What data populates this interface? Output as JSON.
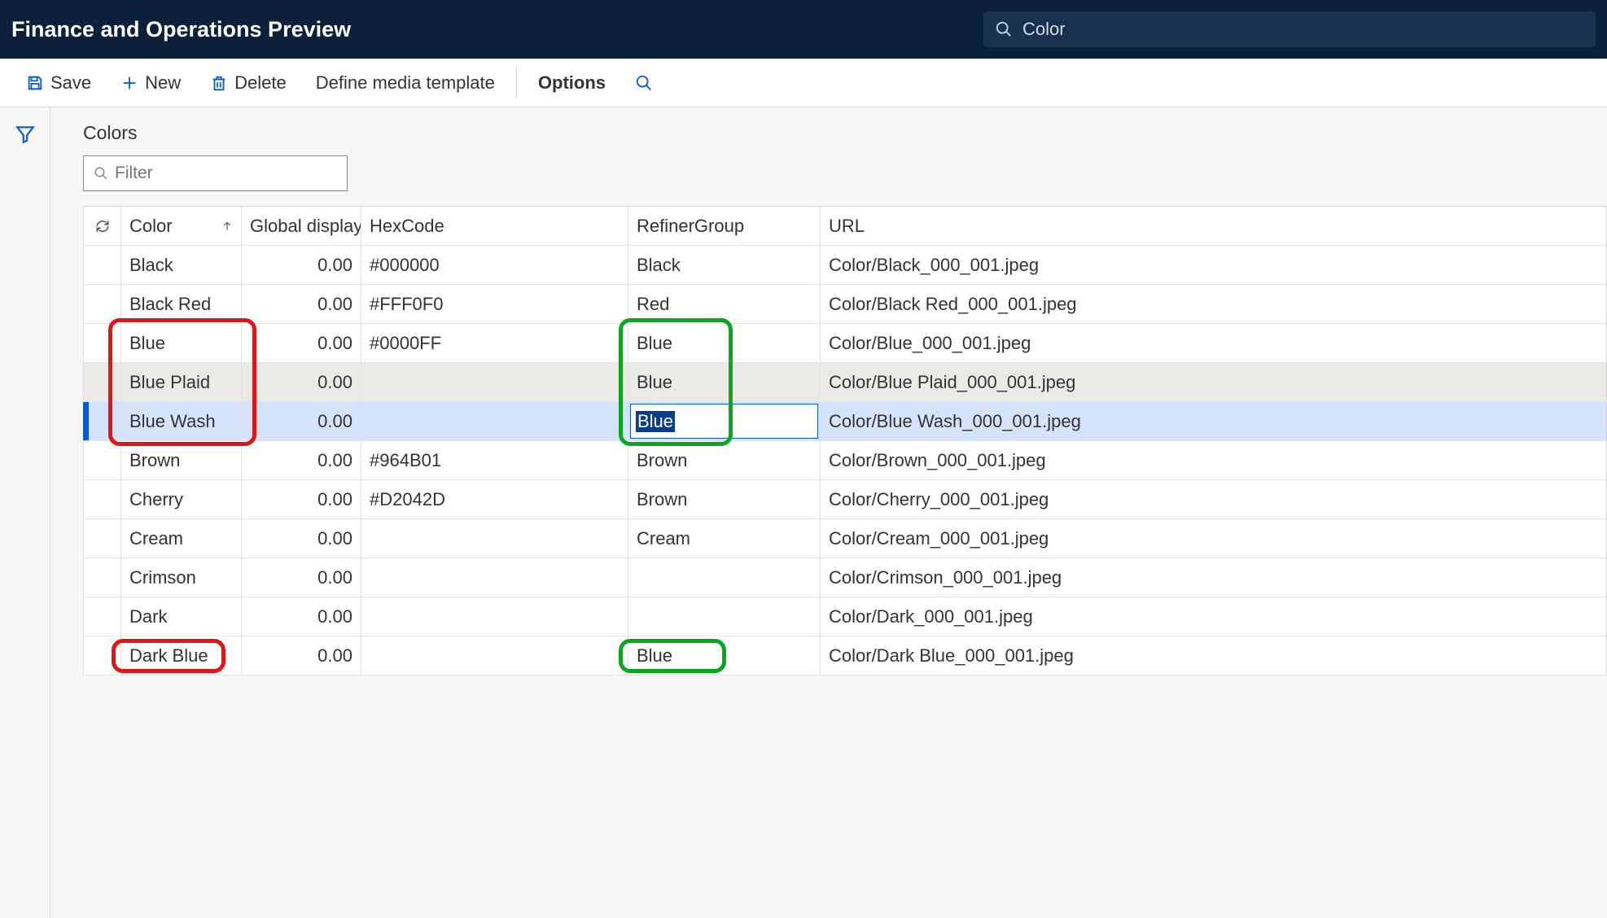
{
  "topbar": {
    "title": "Finance and Operations Preview",
    "search_value": "Color"
  },
  "cmdbar": {
    "save": "Save",
    "new": "New",
    "delete": "Delete",
    "define": "Define media template",
    "options": "Options"
  },
  "page": {
    "title": "Colors",
    "filter_placeholder": "Filter"
  },
  "grid": {
    "headers": {
      "color": "Color",
      "disp": "Global display ...",
      "hex": "HexCode",
      "ref": "RefinerGroup",
      "url": "URL"
    },
    "rows": [
      {
        "color": "Black",
        "disp": "0.00",
        "hex": "#000000",
        "ref": "Black",
        "url": "Color/Black_000_001.jpeg"
      },
      {
        "color": "Black Red",
        "disp": "0.00",
        "hex": "#FFF0F0",
        "ref": "Red",
        "url": "Color/Black Red_000_001.jpeg"
      },
      {
        "color": "Blue",
        "disp": "0.00",
        "hex": "#0000FF",
        "ref": "Blue",
        "url": "Color/Blue_000_001.jpeg"
      },
      {
        "color": "Blue Plaid",
        "disp": "0.00",
        "hex": "",
        "ref": "Blue",
        "url": "Color/Blue Plaid_000_001.jpeg",
        "alt": true
      },
      {
        "color": "Blue Wash",
        "disp": "0.00",
        "hex": "",
        "ref": "Blue",
        "url": "Color/Blue Wash_000_001.jpeg",
        "selected": true,
        "editing": true
      },
      {
        "color": "Brown",
        "disp": "0.00",
        "hex": "#964B01",
        "ref": "Brown",
        "url": "Color/Brown_000_001.jpeg"
      },
      {
        "color": "Cherry",
        "disp": "0.00",
        "hex": "#D2042D",
        "ref": "Brown",
        "url": "Color/Cherry_000_001.jpeg"
      },
      {
        "color": "Cream",
        "disp": "0.00",
        "hex": "",
        "ref": "Cream",
        "url": "Color/Cream_000_001.jpeg"
      },
      {
        "color": "Crimson",
        "disp": "0.00",
        "hex": "",
        "ref": "",
        "url": "Color/Crimson_000_001.jpeg"
      },
      {
        "color": "Dark",
        "disp": "0.00",
        "hex": "",
        "ref": "",
        "url": "Color/Dark_000_001.jpeg"
      },
      {
        "color": "Dark Blue",
        "disp": "0.00",
        "hex": "",
        "ref": "Blue",
        "url": "Color/Dark Blue_000_001.jpeg"
      }
    ]
  }
}
